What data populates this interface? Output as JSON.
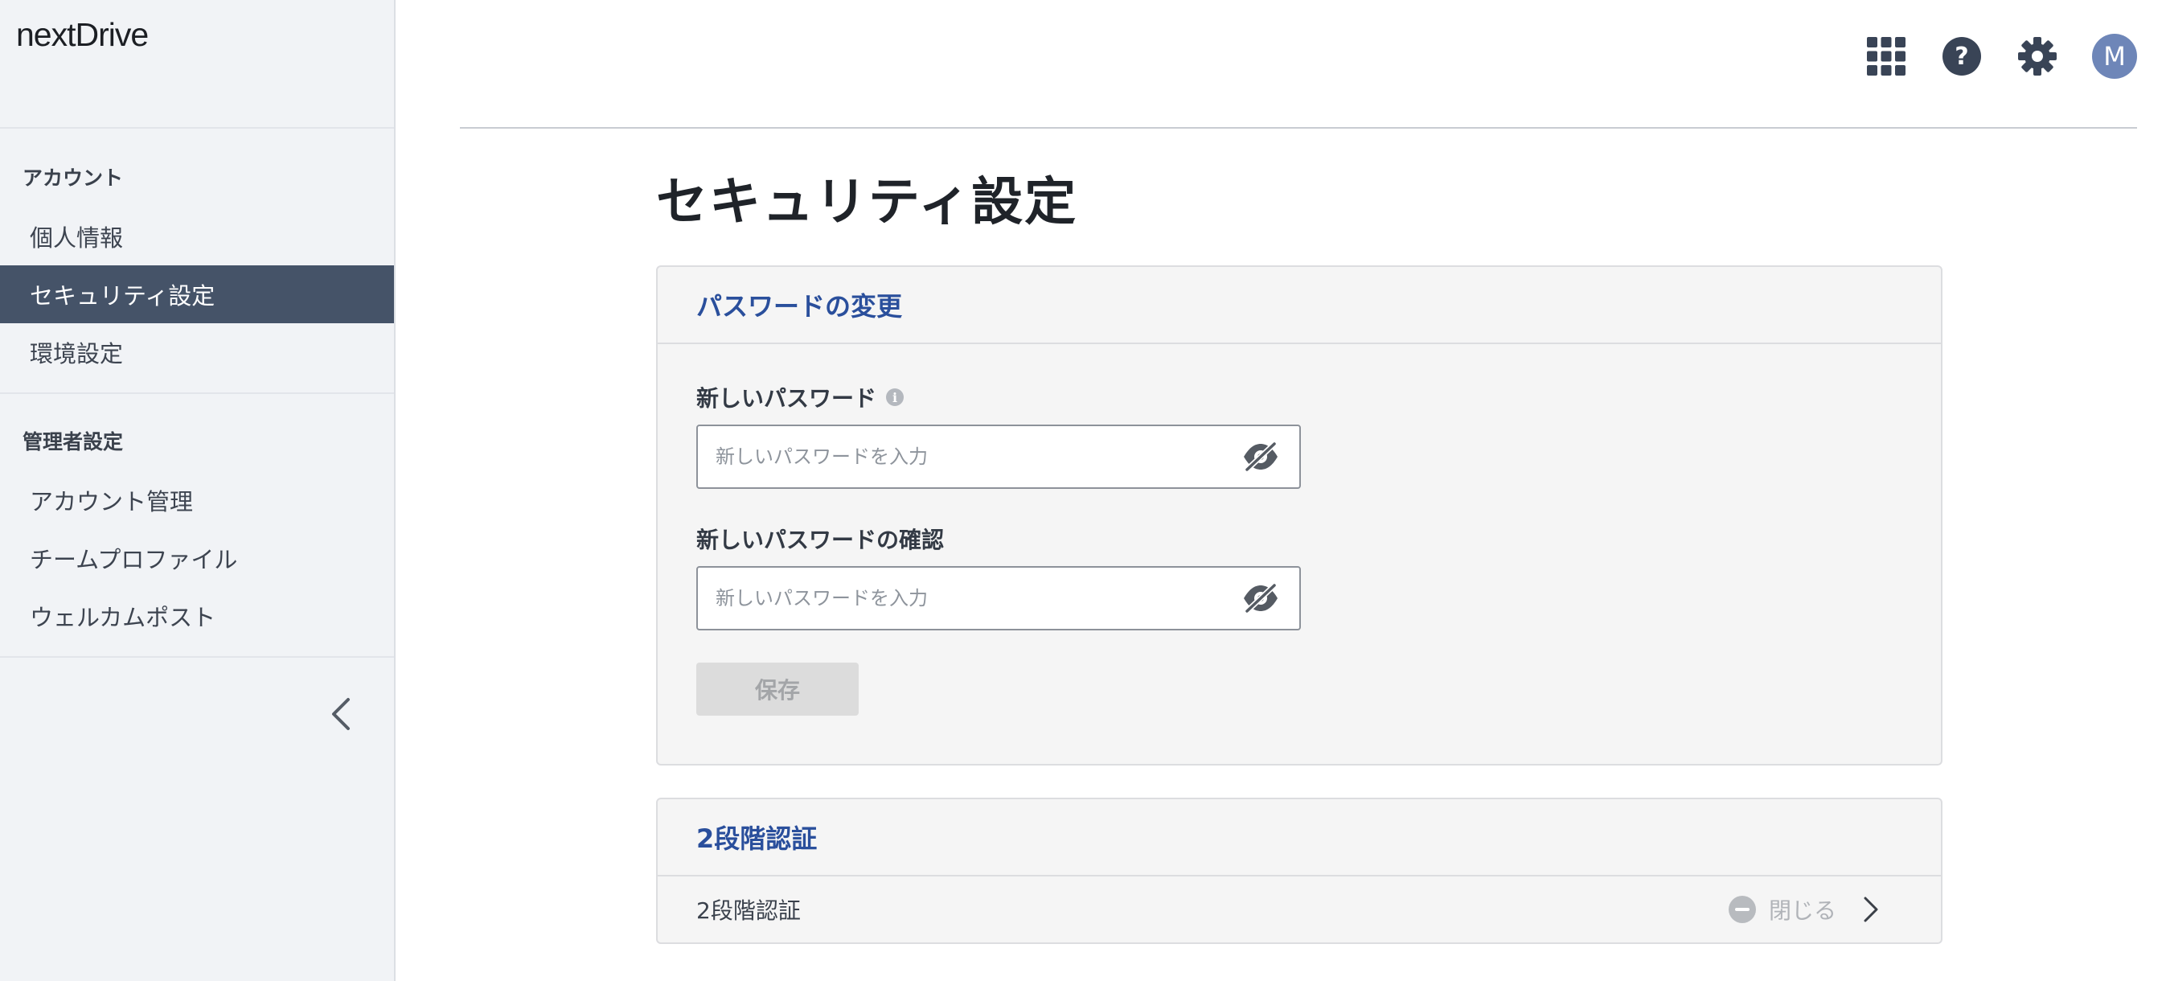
{
  "app": {
    "logo": "nextDrive"
  },
  "sidebar": {
    "sections": [
      {
        "title": "アカウント",
        "items": [
          "個人情報",
          "セキュリティ設定",
          "環境設定"
        ]
      },
      {
        "title": "管理者設定",
        "items": [
          "アカウント管理",
          "チームプロファイル",
          "ウェルカムポスト"
        ]
      }
    ],
    "active_item": "セキュリティ設定"
  },
  "header": {
    "icons": [
      "apps-grid-icon",
      "help-icon",
      "gear-icon"
    ],
    "avatar_initial": "M",
    "avatar_color": "#6e86b8"
  },
  "main": {
    "page_title": "セキュリティ設定",
    "password_card": {
      "title": "パスワードの変更",
      "new_password_label": "新しいパスワード",
      "new_password_placeholder": "新しいパスワードを入力",
      "confirm_password_label": "新しいパスワードの確認",
      "confirm_password_placeholder": "新しいパスワードを入力",
      "save_label": "保存"
    },
    "tfa_card": {
      "title": "2段階認証",
      "row_label": "2段階認証",
      "status": "閉じる"
    }
  },
  "colors": {
    "sidebar_active_bg": "#455368",
    "card_title": "#2a4f9c",
    "card_bg": "#f5f5f5"
  }
}
